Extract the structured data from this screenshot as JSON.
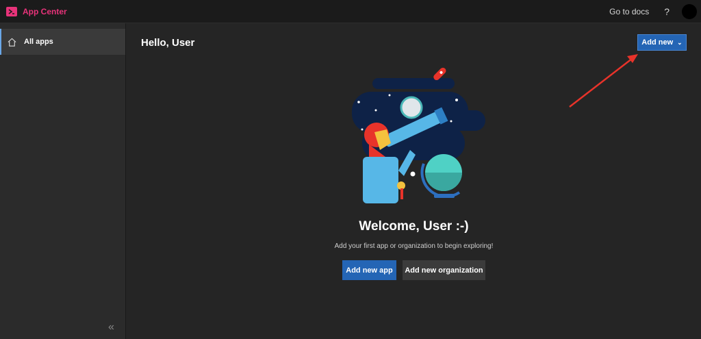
{
  "header": {
    "brand": "App Center",
    "docs_label": "Go to docs",
    "help_glyph": "?",
    "brand_color": "#e8337a"
  },
  "sidebar": {
    "items": [
      {
        "label": "All apps",
        "icon": "home-icon"
      }
    ],
    "collapse_glyph": "«"
  },
  "main": {
    "title": "Hello, User",
    "add_new_label": "Add new",
    "welcome_title": "Welcome, User :-)",
    "welcome_subtitle": "Add your first app or organization to begin exploring!",
    "add_app_label": "Add new app",
    "add_org_label": "Add new organization"
  },
  "colors": {
    "primary": "#2465b5",
    "annotation_arrow": "#e8332a"
  }
}
